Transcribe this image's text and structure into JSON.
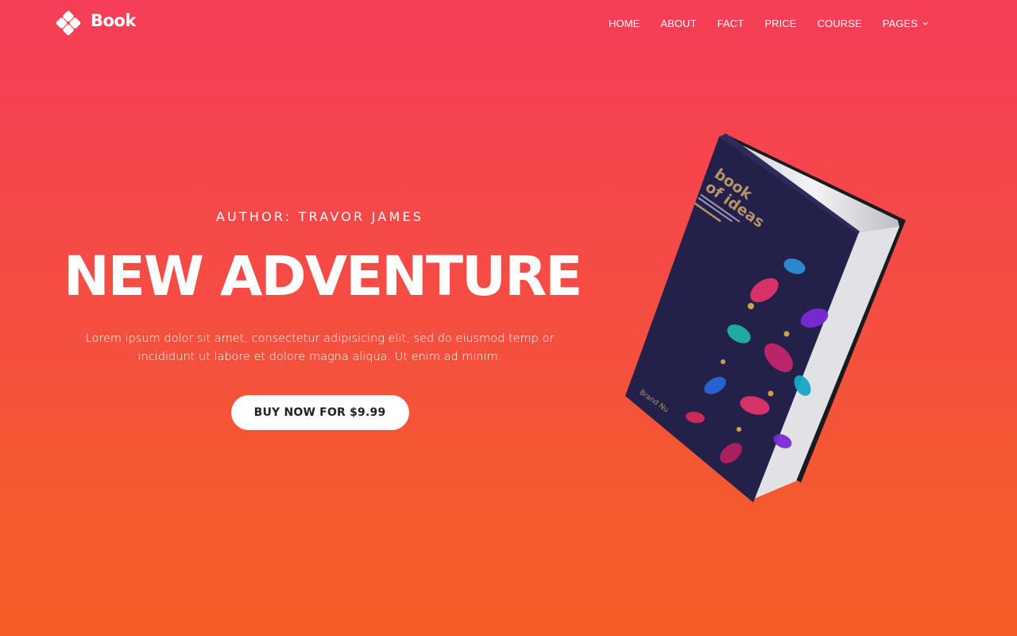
{
  "brand": {
    "name": "Book",
    "logo_icon": "diamond-cluster-icon"
  },
  "nav": {
    "items": [
      {
        "label": "HOME"
      },
      {
        "label": "ABOUT"
      },
      {
        "label": "FACT"
      },
      {
        "label": "PRICE"
      },
      {
        "label": "COURSE"
      },
      {
        "label": "PAGES",
        "icon": "chevron-down-icon"
      }
    ]
  },
  "hero": {
    "author": "AUTHOR: TRAVOR JAMES",
    "title": "NEW ADVENTURE",
    "lead": "Lorem ipsum dolor sit amet, consectetur adipisicing elit, sed do eiusmod temp or incididunt ut labore et dolore magna aliqua. Ut enim ad minim.",
    "cta_label": "BUY NOW FOR $9.99"
  },
  "book_cover": {
    "title_line1": "book",
    "title_line2": "of ideas",
    "publisher": "Brand Nu"
  },
  "colors": {
    "gradient_top": "#f63d57",
    "gradient_bottom": "#f35c23",
    "cover_navy": "#23204a",
    "cover_title": "#b8926a"
  }
}
